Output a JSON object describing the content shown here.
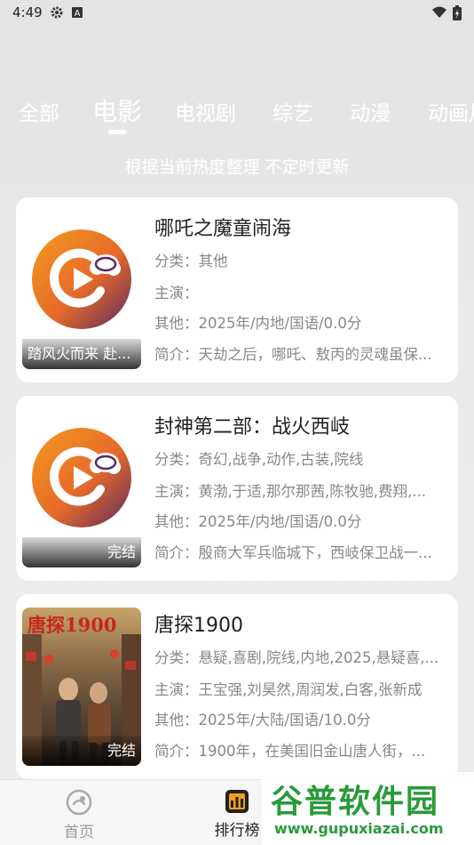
{
  "status_bar": {
    "time": "4:49"
  },
  "tabs": [
    {
      "label": "全部"
    },
    {
      "label": "电影"
    },
    {
      "label": "电视剧"
    },
    {
      "label": "综艺"
    },
    {
      "label": "动漫"
    },
    {
      "label": "动画片"
    }
  ],
  "subtitle": "根据当前热度整理 不定时更新",
  "items": [
    {
      "title": "哪吒之魔童闹海",
      "poster_label": "踏风火而来 赴...",
      "category": "分类：其他",
      "cast": "主演：",
      "other": "其他：2025年/内地/国语/0.0分",
      "intro": "简介：天劫之后，哪吒、敖丙的灵魂虽保..."
    },
    {
      "title": "封神第二部：战火西岐",
      "poster_label": "完结",
      "category": "分类：奇幻,战争,动作,古装,院线",
      "cast": "主演：黄渤,于适,那尔那茜,陈牧驰,费翔,...",
      "other": "其他：2025年/内地/国语/0.0分",
      "intro": "简介：殷商大军兵临城下，西岐保卫战一..."
    },
    {
      "title": "唐探1900",
      "poster_label": "完结",
      "poster_title": "唐探1900",
      "category": "分类：悬疑,喜剧,院线,内地,2025,悬疑喜,...",
      "cast": "主演：王宝强,刘昊然,周润发,白客,张新成",
      "other": "其他：2025年/大陆/国语/10.0分",
      "intro": "简介：1900年，在美国旧金山唐人街，..."
    }
  ],
  "bottom_nav": {
    "home": "首页",
    "ranking": "排行榜"
  },
  "watermark": {
    "brand": "谷普软件园",
    "url": "www.gupuxiazai.com"
  },
  "colors": {
    "accent_orange": "#f08a1c",
    "watermark_green": "#2a9a3a"
  }
}
